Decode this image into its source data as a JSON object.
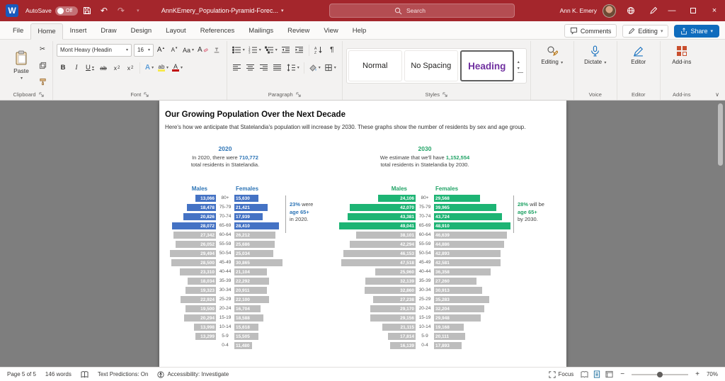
{
  "titlebar": {
    "autosave_label": "AutoSave",
    "autosave_state": "Off",
    "doc_title": "AnnKEmery_Population-Pyramid-Forec...",
    "search_placeholder": "Search",
    "user_name": "Ann K. Emery"
  },
  "menubar": {
    "tabs": [
      "File",
      "Home",
      "Insert",
      "Draw",
      "Design",
      "Layout",
      "References",
      "Mailings",
      "Review",
      "View",
      "Help"
    ],
    "active_tab": "Home",
    "comments_label": "Comments",
    "editing_label": "Editing",
    "share_label": "Share"
  },
  "ribbon": {
    "paste_label": "Paste",
    "font_name": "Mont Heavy (Headin",
    "font_size": "16",
    "style_normal": "Normal",
    "style_nospacing": "No Spacing",
    "style_heading": "Heading",
    "group_clipboard": "Clipboard",
    "group_font": "Font",
    "group_paragraph": "Paragraph",
    "group_styles": "Styles",
    "group_voice": "Voice",
    "group_editor": "Editor",
    "group_addins": "Add-ins",
    "btn_editing": "Editing",
    "btn_dictate": "Dictate",
    "btn_editor": "Editor",
    "btn_addins": "Add-ins"
  },
  "document": {
    "heading": "Our Growing Population Over the Next Decade",
    "intro": "Here's how we anticipate that Statelandia's population will increase by 2030. These graphs show the number of residents by sex and age group."
  },
  "chart_data": [
    {
      "type": "bar",
      "subtype": "population_pyramid",
      "title": "2020",
      "desc_before": "In 2020, there were ",
      "desc_value": "710,772",
      "desc_after": "total residents in Statelandia.",
      "left_series_label": "Males",
      "right_series_label": "Females",
      "accent_text_color": "#2E75B6",
      "bar_color": "#4472C4",
      "gray_color": "#BDBDBD",
      "highlight_rows": 4,
      "scale_max": 49041,
      "categories": [
        "80+",
        "75-79",
        "70-74",
        "65-69",
        "60-64",
        "55-59",
        "50-54",
        "45-49",
        "40-44",
        "35-39",
        "30-34",
        "25-29",
        "20-24",
        "15-19",
        "10-14",
        "5-9",
        "0-4"
      ],
      "males": [
        "13,066",
        "18,478",
        "20,826",
        "28,072",
        "27,342",
        "26,052",
        "29,494",
        "28,500",
        "23,310",
        "18,034",
        "19,323",
        "22,924",
        "19,500",
        "20,294",
        "13,998",
        "13,299",
        ""
      ],
      "females": [
        "15,630",
        "21,421",
        "17,939",
        "28,410",
        "26,212",
        "25,686",
        "25,034",
        "30,865",
        "21,104",
        "22,292",
        "20,911",
        "22,100",
        "16,704",
        "18,588",
        "15,618",
        "15,505",
        "11,480"
      ],
      "callout": {
        "accent1": "23%",
        "rest1": " were",
        "accent2": "age 65+",
        "rest2": "in 2020."
      }
    },
    {
      "type": "bar",
      "subtype": "population_pyramid",
      "title": "2030",
      "desc_before": "We estimate that we'll have ",
      "desc_value": "1,152,554",
      "desc_after": "total residents in Statelandia by 2030.",
      "left_series_label": "Males",
      "right_series_label": "Females",
      "accent_text_color": "#21A366",
      "bar_color": "#1DB474",
      "gray_color": "#BDBDBD",
      "highlight_rows": 4,
      "scale_max": 49041,
      "categories": [
        "80+",
        "75-79",
        "70-74",
        "65-69",
        "60-64",
        "55-59",
        "50-54",
        "45-49",
        "40-44",
        "35-39",
        "30-34",
        "25-29",
        "20-24",
        "15-19",
        "10-14",
        "5-9",
        "0-4"
      ],
      "males": [
        "24,106",
        "42,070",
        "43,381",
        "49,041",
        "38,101",
        "42,294",
        "46,153",
        "47,518",
        "25,960",
        "32,139",
        "32,860",
        "27,238",
        "29,170",
        "29,156",
        "21,115",
        "17,814",
        "16,139"
      ],
      "females": [
        "29,568",
        "39,965",
        "43,724",
        "48,910",
        "46,639",
        "44,886",
        "42,893",
        "42,581",
        "36,358",
        "27,260",
        "30,913",
        "35,283",
        "32,204",
        "29,948",
        "19,168",
        "20,111",
        "17,893"
      ],
      "callout": {
        "accent1": "28%",
        "rest1": " will be",
        "accent2": "age 65+",
        "rest2": "by 2030."
      }
    }
  ],
  "statusbar": {
    "page": "Page 5 of 5",
    "words": "146 words",
    "predictions": "Text Predictions: On",
    "accessibility": "Accessibility: Investigate",
    "focus": "Focus",
    "zoom": "70%"
  }
}
